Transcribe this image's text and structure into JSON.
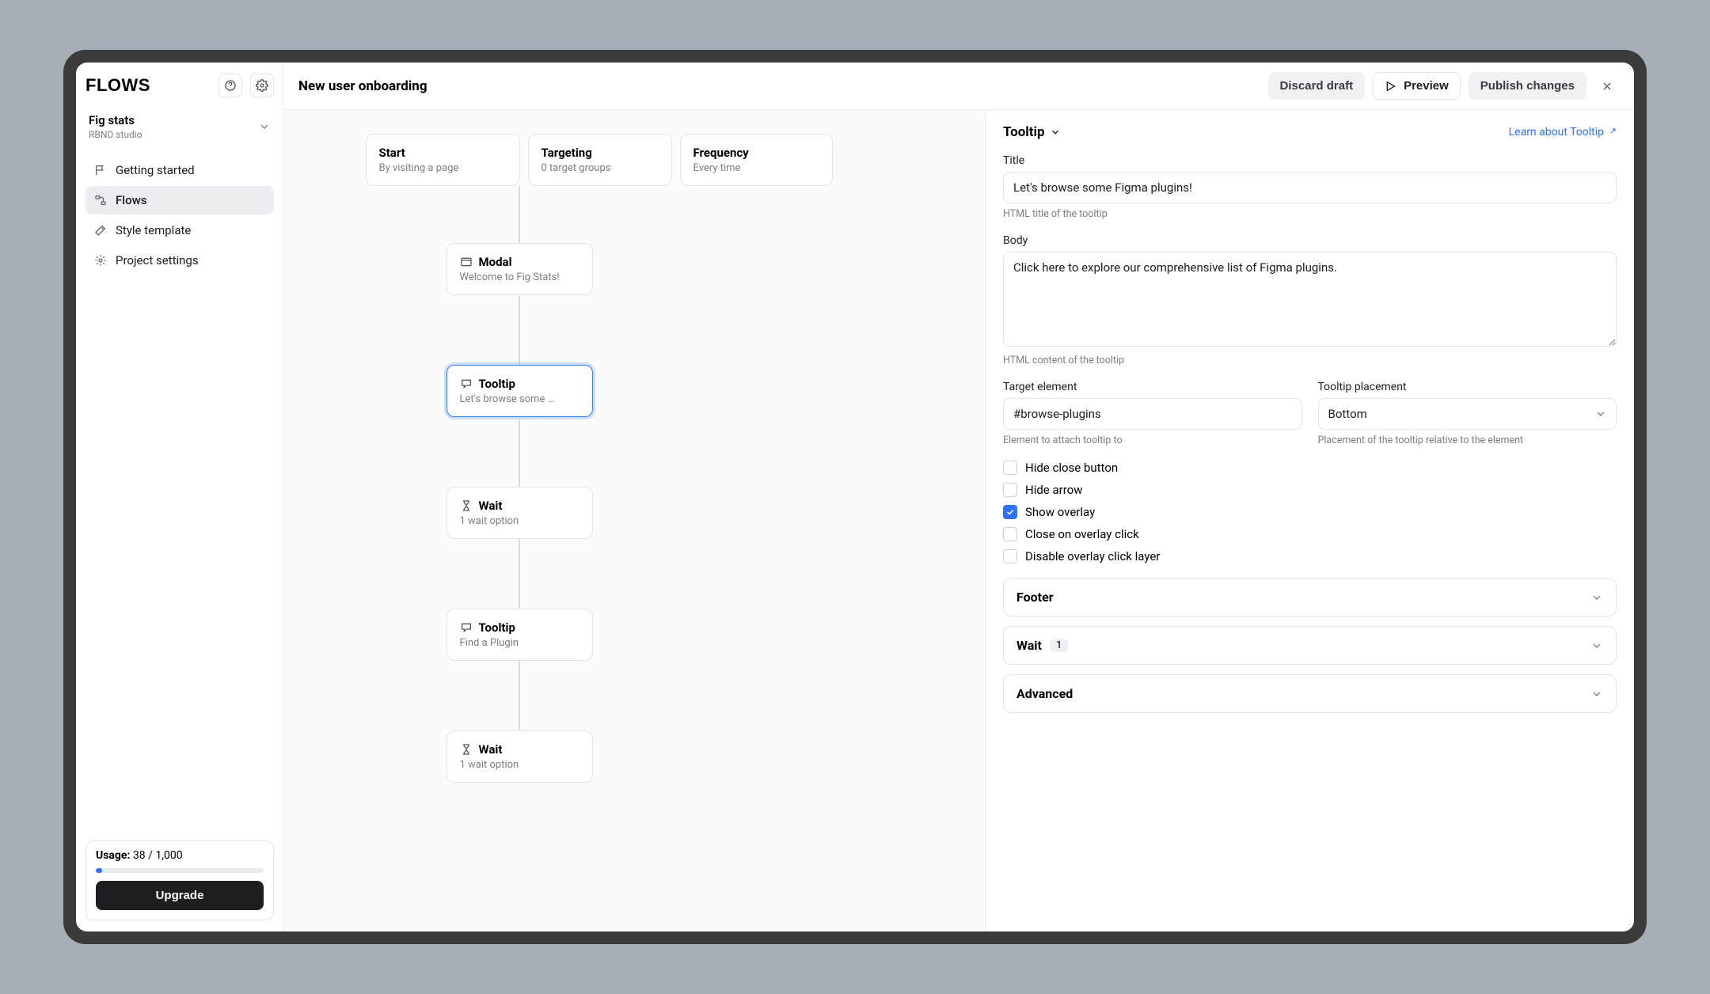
{
  "app": {
    "logo_text": "FLOWS"
  },
  "project": {
    "name": "Fig stats",
    "org": "RBND studio"
  },
  "sidebar": {
    "items": [
      {
        "label": "Getting started",
        "icon": "flag"
      },
      {
        "label": "Flows",
        "icon": "flow"
      },
      {
        "label": "Style template",
        "icon": "wand"
      },
      {
        "label": "Project settings",
        "icon": "gear"
      }
    ],
    "usage": {
      "label": "Usage:",
      "value": "38 / 1,000",
      "percent": 4
    },
    "upgrade_label": "Upgrade"
  },
  "header": {
    "title": "New user onboarding",
    "discard_label": "Discard draft",
    "preview_label": "Preview",
    "publish_label": "Publish changes"
  },
  "flow": {
    "start": {
      "title": "Start",
      "subtitle": "By visiting a page"
    },
    "targeting": {
      "title": "Targeting",
      "subtitle": "0 target groups"
    },
    "frequency": {
      "title": "Frequency",
      "subtitle": "Every time"
    },
    "steps": [
      {
        "kind": "Modal",
        "title": "Modal",
        "subtitle": "Welcome to Fig Stats!"
      },
      {
        "kind": "Tooltip",
        "title": "Tooltip",
        "subtitle": "Let's browse some …",
        "selected": true
      },
      {
        "kind": "Wait",
        "title": "Wait",
        "subtitle": "1 wait option"
      },
      {
        "kind": "Tooltip",
        "title": "Tooltip",
        "subtitle": "Find a Plugin"
      },
      {
        "kind": "Wait",
        "title": "Wait",
        "subtitle": "1 wait option"
      }
    ]
  },
  "inspector": {
    "type_label": "Tooltip",
    "learn_link": "Learn about Tooltip",
    "title": {
      "label": "Title",
      "value": "Let's browse some Figma plugins!",
      "help": "HTML title of the tooltip"
    },
    "body": {
      "label": "Body",
      "value": "Click here to explore our comprehensive list of Figma plugins.",
      "help": "HTML content of the tooltip"
    },
    "target": {
      "label": "Target element",
      "value": "#browse-plugins",
      "help": "Element to attach tooltip to"
    },
    "placement": {
      "label": "Tooltip placement",
      "value": "Bottom",
      "help": "Placement of the tooltip relative to the element"
    },
    "checks": [
      {
        "label": "Hide close button",
        "checked": false
      },
      {
        "label": "Hide arrow",
        "checked": false
      },
      {
        "label": "Show overlay",
        "checked": true
      },
      {
        "label": "Close on overlay click",
        "checked": false
      },
      {
        "label": "Disable overlay click layer",
        "checked": false
      }
    ],
    "sections": {
      "footer": {
        "label": "Footer"
      },
      "wait": {
        "label": "Wait",
        "badge": "1"
      },
      "advanced": {
        "label": "Advanced"
      }
    }
  }
}
